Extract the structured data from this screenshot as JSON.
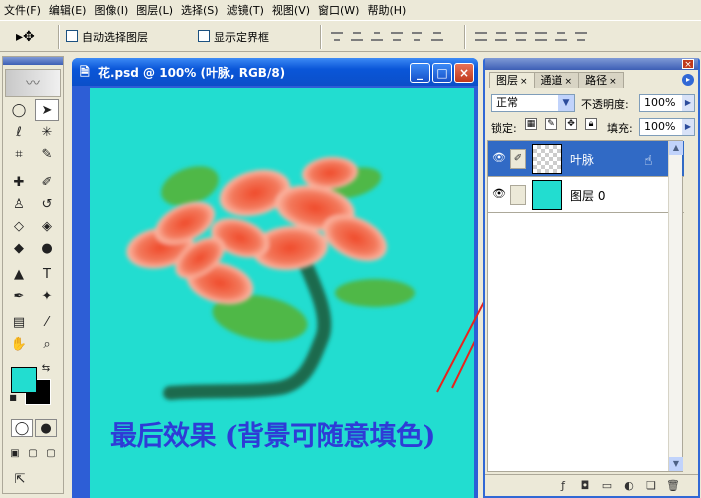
{
  "menubar": {
    "items": [
      "文件(F)",
      "编辑(E)",
      "图像(I)",
      "图层(L)",
      "选择(S)",
      "滤镜(T)",
      "视图(V)",
      "窗口(W)",
      "帮助(H)"
    ]
  },
  "options": {
    "auto_select_label": "自动选择图层",
    "show_bounds_label": "显示定界框"
  },
  "document": {
    "title": "花.psd @ 100% (叶脉, RGB/8)",
    "caption": "最后效果 (背景可随意填色)",
    "background_color": "#22ddd0",
    "caption_color": "#2e3cd6"
  },
  "layers_panel": {
    "tabs": [
      "图层",
      "通道",
      "路径"
    ],
    "blend_mode": "正常",
    "opacity_label": "不透明度:",
    "opacity_value": "100%",
    "lock_label": "锁定:",
    "fill_label": "填充:",
    "fill_value": "100%",
    "layers": [
      {
        "name": "叶脉",
        "selected": true
      },
      {
        "name": "图层 0",
        "selected": false
      }
    ]
  },
  "colors": {
    "foreground": "#22ddd0",
    "background": "#000000",
    "accent": "#316ac5"
  }
}
